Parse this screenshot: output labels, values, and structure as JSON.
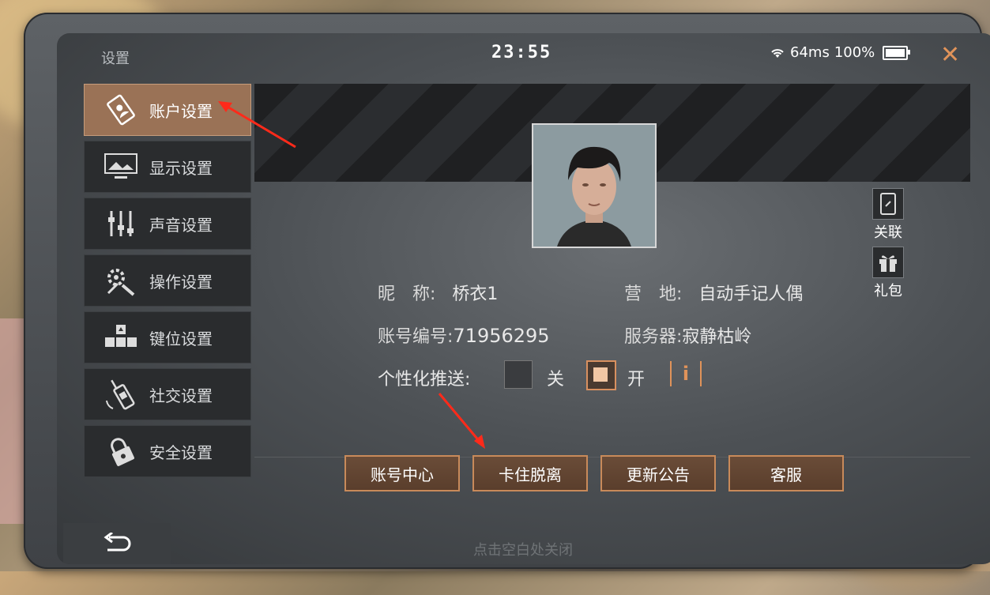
{
  "header": {
    "title": "设置",
    "clock": "23:55",
    "ping": "64ms",
    "battery": "100%"
  },
  "sidebar": {
    "items": [
      {
        "label": "账户设置",
        "icon": "account-card-icon",
        "active": true
      },
      {
        "label": "显示设置",
        "icon": "display-monitor-icon"
      },
      {
        "label": "声音设置",
        "icon": "sound-sliders-icon"
      },
      {
        "label": "操作设置",
        "icon": "gear-tools-icon"
      },
      {
        "label": "键位设置",
        "icon": "keyboard-keys-icon"
      },
      {
        "label": "社交设置",
        "icon": "walkie-talkie-icon"
      },
      {
        "label": "安全设置",
        "icon": "padlock-icon"
      }
    ]
  },
  "profile": {
    "nickname_label": "昵　称:",
    "nickname": "桥衣1",
    "camp_label": "营　地:",
    "camp": "自动手记人偶",
    "account_label": "账号编号:",
    "account": "71956295",
    "server_label": "服务器:",
    "server": "寂静枯岭",
    "push_label": "个性化推送:",
    "push_off": "关",
    "push_on": "开",
    "push_state": "on"
  },
  "side_actions": {
    "link": "关联",
    "gift": "礼包"
  },
  "buttons": {
    "account_center": "账号中心",
    "unstuck": "卡住脱离",
    "announcement": "更新公告",
    "support": "客服"
  },
  "footer": {
    "hint": "点击空白处关闭"
  },
  "colors": {
    "accent": "#c88a5a",
    "active_tab": "#9a7256",
    "close": "#e0935a",
    "annotation_arrow": "#ff2a1a"
  }
}
